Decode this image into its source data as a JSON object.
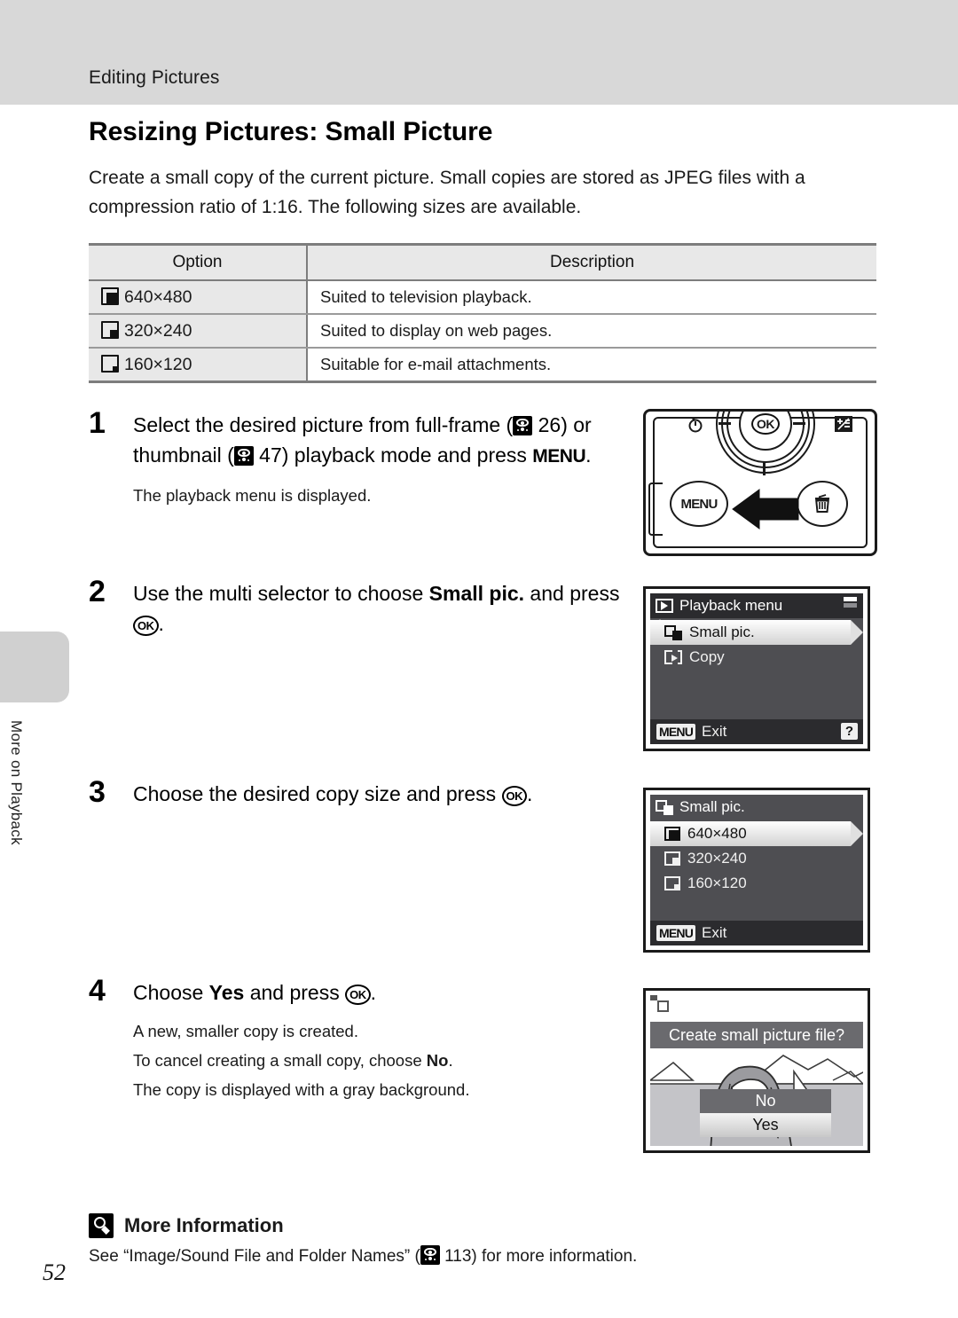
{
  "header": {
    "running_title": "Editing Pictures"
  },
  "side_tab": {
    "label": "More on Playback"
  },
  "page_number": "52",
  "section": {
    "title": "Resizing Pictures: Small Picture",
    "intro": "Create a small copy of the current picture. Small copies are stored as JPEG files with a compression ratio of 1:16. The following sizes are available."
  },
  "table": {
    "headers": [
      "Option",
      "Description"
    ],
    "rows": [
      {
        "option": "640×480",
        "description": "Suited to television playback."
      },
      {
        "option": "320×240",
        "description": "Suited to display on web pages."
      },
      {
        "option": "160×120",
        "description": "Suitable for e-mail attachments."
      }
    ]
  },
  "steps": [
    {
      "number": "1",
      "text_a": "Select the desired picture from full-frame (",
      "ref_1": " 26) or thumbnail (",
      "ref_2": " 47) playback mode and press ",
      "menu_label": "MENU",
      "text_end": ".",
      "note": [
        "The playback menu is displayed."
      ]
    },
    {
      "number": "2",
      "text_a": "Use the multi selector to choose ",
      "bold": "Small pic.",
      "text_b": " and press ",
      "ok_label": "OK",
      "text_end": ".",
      "note": []
    },
    {
      "number": "3",
      "text_a": "Choose the desired copy size and press ",
      "ok_label": "OK",
      "text_end": ".",
      "note": []
    },
    {
      "number": "4",
      "text_a": "Choose ",
      "bold": "Yes",
      "text_b": " and press ",
      "ok_label": "OK",
      "text_end": ".",
      "note": [
        "A new, smaller copy is created.",
        "To cancel creating a small copy, choose ",
        "The copy is displayed with a gray background."
      ],
      "note_bold": "No",
      "note_bold_tail": "."
    }
  ],
  "camera_figure": {
    "ok_label": "OK",
    "menu_label": "MENU",
    "icons": [
      "self-timer-icon",
      "exposure-compensation-icon",
      "delete-icon",
      "multi-selector-dial",
      "arrow-pointer"
    ]
  },
  "playback_menu_screen": {
    "title": "Playback menu",
    "items": [
      {
        "label": "Small pic.",
        "selected": true
      },
      {
        "label": "Copy",
        "selected": false
      }
    ],
    "bottom": {
      "menu_chip": "MENU",
      "action": "Exit",
      "help": "?"
    }
  },
  "small_pic_screen": {
    "title": "Small pic.",
    "items": [
      {
        "label": "640×480",
        "selected": true
      },
      {
        "label": "320×240",
        "selected": false
      },
      {
        "label": "160×120",
        "selected": false
      }
    ],
    "bottom": {
      "menu_chip": "MENU",
      "action": "Exit"
    }
  },
  "confirm_screen": {
    "question": "Create small picture file?",
    "options": [
      {
        "label": "No",
        "selected": false
      },
      {
        "label": "Yes",
        "selected": true
      }
    ]
  },
  "more_information": {
    "heading": "More Information",
    "text_a": "See “Image/Sound File and Folder Names” (",
    "text_b": " 113) for more information."
  },
  "colors": {
    "header_band": "#d8d8d8",
    "table_header": "#e8e8e8",
    "lcd_body": "#4e4e52",
    "lcd_bar": "#2b2b2e",
    "confirm_bar": "#6a6a6e"
  }
}
